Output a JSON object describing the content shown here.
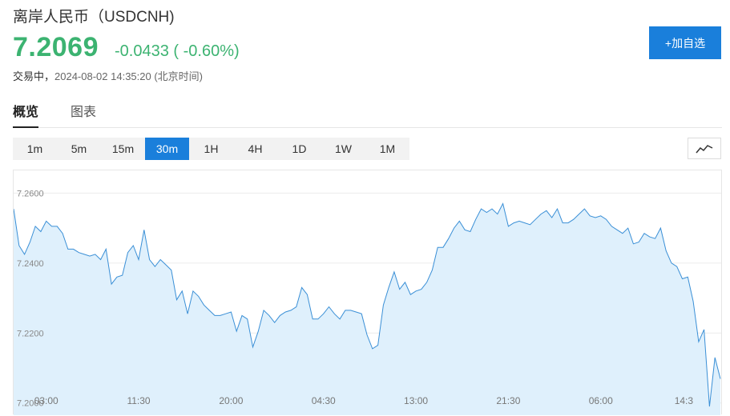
{
  "header": {
    "title": "离岸人民币（USDCNH)",
    "price": "7.2069",
    "change": "-0.0433",
    "change_pct": "( -0.60%)",
    "status_label": "交易中，",
    "timestamp": "2024-08-02 14:35:20 (北京时间)",
    "add_button_label": "+加自选"
  },
  "tabs": [
    {
      "label": "概览",
      "active": true
    },
    {
      "label": "图表",
      "active": false
    }
  ],
  "intervals": [
    {
      "label": "1m",
      "active": false
    },
    {
      "label": "5m",
      "active": false
    },
    {
      "label": "15m",
      "active": false
    },
    {
      "label": "30m",
      "active": true
    },
    {
      "label": "1H",
      "active": false
    },
    {
      "label": "4H",
      "active": false
    },
    {
      "label": "1D",
      "active": false
    },
    {
      "label": "1W",
      "active": false
    },
    {
      "label": "1M",
      "active": false
    }
  ],
  "chart_type_icon": "line-chart-icon",
  "colors": {
    "accent": "#1a7fdb",
    "up_down": "#3cb371",
    "line": "#3a8fd6",
    "fill": "#dff0fc"
  },
  "chart_data": {
    "type": "area",
    "y_ticks": [
      "7.2600",
      "7.2400",
      "7.2200",
      "7.2000"
    ],
    "y_tick_values": [
      7.26,
      7.24,
      7.22,
      7.2
    ],
    "x_ticks": [
      "03:00",
      "11:30",
      "20:00",
      "04:30",
      "13:00",
      "21:30",
      "06:00",
      "14:3"
    ],
    "x_tick_index": [
      6,
      23,
      40,
      57,
      74,
      91,
      108,
      125
    ],
    "ylim": [
      7.1965,
      7.2665
    ],
    "grid": true,
    "values": [
      7.2555,
      7.245,
      7.2425,
      7.246,
      7.2505,
      7.249,
      7.252,
      7.2505,
      7.2505,
      7.2485,
      7.244,
      7.244,
      7.243,
      7.2425,
      7.242,
      7.2425,
      7.241,
      7.244,
      7.234,
      7.236,
      7.2365,
      7.243,
      7.245,
      7.241,
      7.2495,
      7.241,
      7.239,
      7.241,
      7.2395,
      7.238,
      7.2295,
      7.232,
      7.2255,
      7.232,
      7.2305,
      7.228,
      7.2265,
      7.225,
      7.225,
      7.2255,
      7.226,
      7.2205,
      7.225,
      7.224,
      7.216,
      7.2205,
      7.2265,
      7.225,
      7.223,
      7.225,
      7.226,
      7.2265,
      7.2275,
      7.233,
      7.231,
      7.224,
      7.224,
      7.2255,
      7.2275,
      7.2255,
      7.224,
      7.2265,
      7.2265,
      7.226,
      7.2255,
      7.2195,
      7.2155,
      7.2165,
      7.228,
      7.233,
      7.2375,
      7.2325,
      7.2345,
      7.231,
      7.232,
      7.2325,
      7.2345,
      7.238,
      7.2445,
      7.2445,
      7.247,
      7.25,
      7.252,
      7.2495,
      7.249,
      7.2525,
      7.2555,
      7.2545,
      7.2555,
      7.254,
      7.257,
      7.2505,
      7.2515,
      7.252,
      7.2515,
      7.251,
      7.2525,
      7.254,
      7.255,
      7.253,
      7.2555,
      7.2515,
      7.2515,
      7.2525,
      7.254,
      7.2555,
      7.2535,
      7.253,
      7.2535,
      7.2525,
      7.2505,
      7.2495,
      7.2485,
      7.25,
      7.2455,
      7.246,
      7.2485,
      7.2475,
      7.247,
      7.25,
      7.2435,
      7.24,
      7.239,
      7.2355,
      7.236,
      7.229,
      7.2175,
      7.221,
      7.199,
      7.213,
      7.2069
    ]
  }
}
